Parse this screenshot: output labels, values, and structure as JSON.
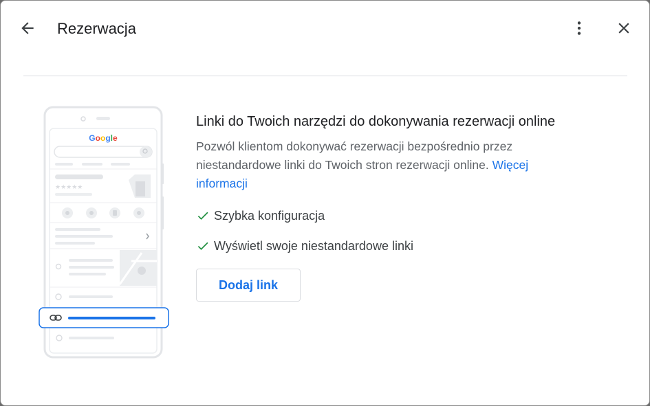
{
  "header": {
    "title": "Rezerwacja",
    "back_icon": "arrow-back-icon",
    "menu_icon": "more-vert-icon",
    "close_icon": "close-icon"
  },
  "illustration": {
    "logo_text": "Google"
  },
  "main": {
    "heading": "Linki do Twoich narzędzi do dokonywania rezerwacji online",
    "description": "Pozwól klientom dokonywać rezerwacji bezpośrednio przez niestandardowe linki do Twoich stron rezerwacji online.",
    "learn_more": "Więcej informacji",
    "features": [
      {
        "label": "Szybka konfiguracja"
      },
      {
        "label": "Wyświetl swoje niestandardowe linki"
      }
    ],
    "add_button": "Dodaj link"
  },
  "colors": {
    "accent": "#1a73e8",
    "check": "#1e8e3e",
    "text": "#202124",
    "secondary_text": "#5f6368"
  }
}
